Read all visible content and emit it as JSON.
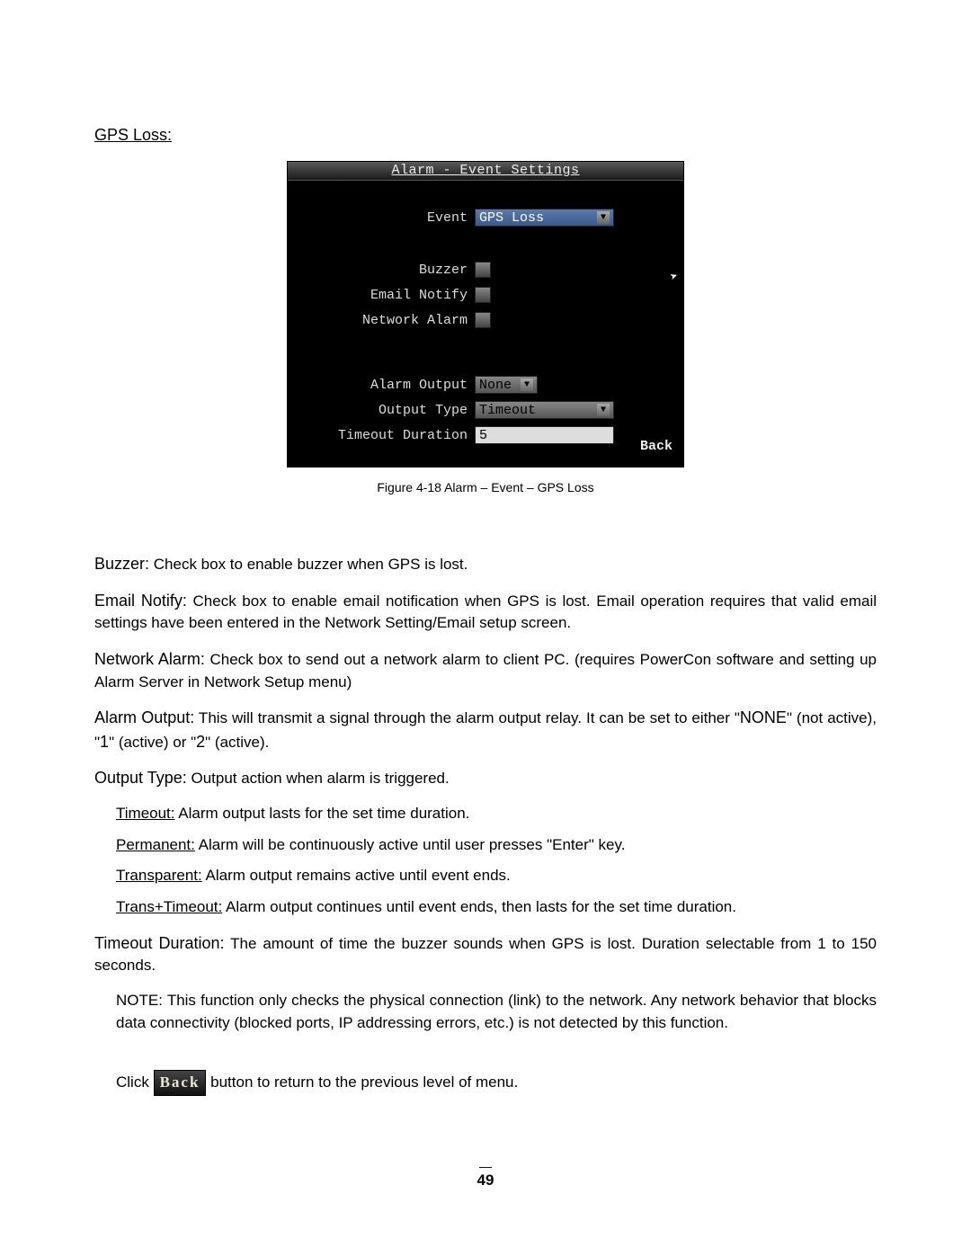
{
  "heading": "GPS Loss:",
  "dvr": {
    "title": "Alarm - Event Settings",
    "rows": {
      "event_label": "Event",
      "event_value": "GPS Loss",
      "buzzer_label": "Buzzer",
      "email_label": "Email Notify",
      "network_label": "Network Alarm",
      "alarm_output_label": "Alarm Output",
      "alarm_output_value": "None",
      "output_type_label": "Output Type",
      "output_type_value": "Timeout",
      "timeout_duration_label": "Timeout Duration",
      "timeout_duration_value": "5"
    },
    "back": "Back"
  },
  "figure_caption": "Figure 4-18 Alarm – Event – GPS Loss",
  "descriptions": {
    "buzzer_term": "Buzzer:",
    "buzzer_text": " Check box to enable buzzer when GPS is lost.",
    "email_term": "Email Notify:",
    "email_text": " Check box to enable email notification when GPS is lost.  Email operation requires that valid email settings have been entered in the Network Setting/Email setup screen.",
    "network_term": "Network Alarm:",
    "network_text": " Check box to send out a network alarm to client PC. (requires PowerCon software and setting up Alarm Server in Network Setup menu)",
    "alarm_output_term": "Alarm Output:",
    "alarm_output_text_a": " This will transmit a signal through the alarm output relay. It can be set to either \"",
    "alarm_output_none": "NONE",
    "alarm_output_text_b": "\" (not active), \"",
    "alarm_output_one": "1",
    "alarm_output_text_c": "\" (active) or \"",
    "alarm_output_two": "2",
    "alarm_output_text_d": "\" (active).",
    "output_type_term": "Output Type:",
    "output_type_text": " Output action when alarm is triggered.",
    "sub": {
      "timeout_u": "Timeout:",
      "timeout_t": " Alarm output lasts for the set time duration.",
      "permanent_u": "Permanent:",
      "permanent_t_a": " Alarm will be continuously active until user presses \"",
      "permanent_enter": "Enter",
      "permanent_t_b": "\" key.",
      "transparent_u": "Transparent:",
      "transparent_t": " Alarm output remains active until event ends.",
      "trans_timeout_u": "Trans+Timeout:",
      "trans_timeout_t": " Alarm output continues until event ends, then lasts for the set time duration."
    },
    "timeout_dur_term": "Timeout Duration:",
    "timeout_dur_text": " The amount of time the buzzer sounds when GPS is lost. Duration selectable from 1 to 150 seconds.",
    "note_term": "NOTE:",
    "note_text": " This function only checks the physical connection (link) to the network. Any network behavior that blocks data connectivity (blocked ports, IP addressing errors, etc.) is not detected by this function.",
    "click_a": "Click ",
    "click_back": "Back",
    "click_b": " button to return to the previous level of menu."
  },
  "page_number": "49"
}
